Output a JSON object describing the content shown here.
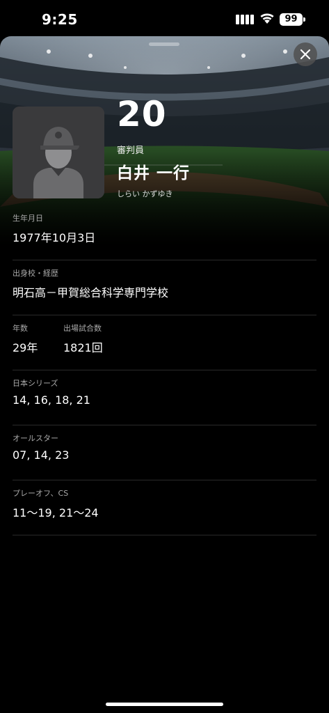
{
  "status_bar": {
    "time": "9:25",
    "battery": "99"
  },
  "player": {
    "number": "20",
    "role": "審判員",
    "name": "白井 一行",
    "kana": "しらい かずゆき"
  },
  "info": {
    "birthday": {
      "label": "生年月日",
      "value": "1977年10月3日"
    },
    "school": {
      "label": "出身校・経歴",
      "value": "明石高－甲賀総合科学専門学校"
    },
    "years": {
      "label": "年数",
      "value": "29年"
    },
    "games": {
      "label": "出場試合数",
      "value": "1821回"
    },
    "japan_series": {
      "label": "日本シリーズ",
      "value": "14, 16, 18, 21"
    },
    "all_star": {
      "label": "オールスター",
      "value": "07, 14, 23"
    },
    "playoff": {
      "label": "プレーオフ、CS",
      "value": "11～19, 21～24"
    }
  },
  "icons": {
    "close": "close-icon",
    "avatar": "person-silhouette-icon",
    "signal": "cellular-signal-icon",
    "wifi": "wifi-icon",
    "battery": "battery-icon"
  }
}
